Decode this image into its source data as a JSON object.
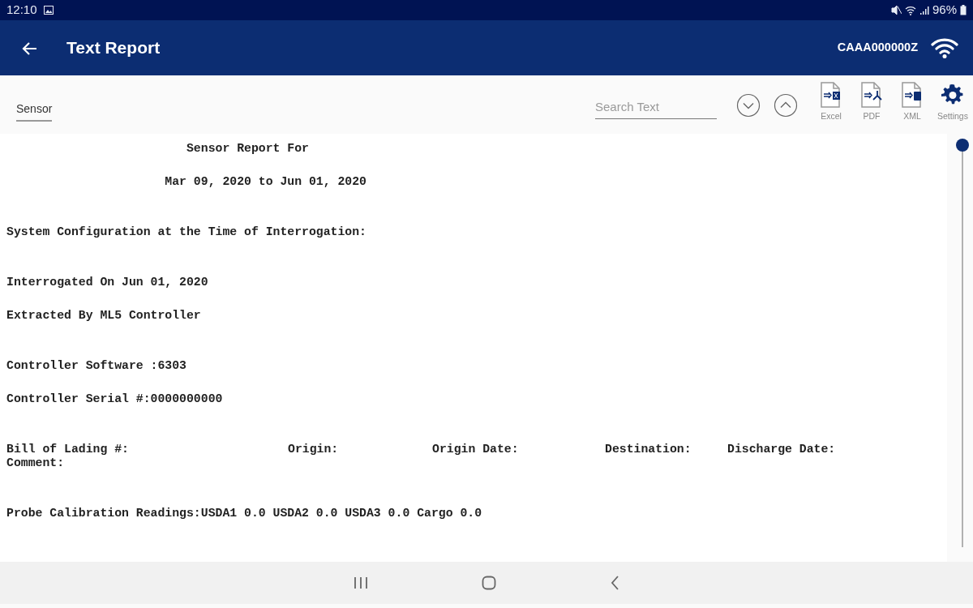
{
  "status_bar": {
    "time": "12:10",
    "battery": "96%"
  },
  "app_bar": {
    "title": "Text Report",
    "device_id": "CAAA000000Z"
  },
  "toolbar": {
    "tab": "Sensor",
    "search": {
      "placeholder": "Search Text"
    },
    "exports": [
      {
        "kind": "excel",
        "label": "Excel"
      },
      {
        "kind": "pdf",
        "label": "PDF"
      },
      {
        "kind": "xml",
        "label": "XML"
      },
      {
        "kind": "settings",
        "label": "Settings"
      }
    ]
  },
  "report": {
    "sections": [
      {
        "lines": [
          {
            "kind": "line",
            "text": "                         Sensor Report For"
          },
          {
            "kind": "line",
            "text": "                      Mar 09, 2020 to Jun 01, 2020"
          }
        ]
      },
      {
        "lines": [
          {
            "kind": "line",
            "text": "System Configuration at the Time of Interrogation:"
          }
        ]
      },
      {
        "lines": [
          {
            "kind": "line",
            "text": "Interrogated On Jun 01, 2020"
          },
          {
            "kind": "line",
            "text": "Extracted By ML5 Controller"
          }
        ]
      },
      {
        "lines": [
          {
            "kind": "line",
            "text": "Controller Software :6303"
          },
          {
            "kind": "line",
            "text": "Controller Serial #:0000000000"
          }
        ]
      },
      {
        "lines": [
          {
            "kind": "fields",
            "fields": [
              "Bill of Lading #:",
              "Origin:",
              "Origin Date:",
              "Destination:",
              "Discharge Date:"
            ]
          },
          {
            "kind": "tight",
            "text": "Comment:"
          }
        ]
      },
      {
        "lines": [
          {
            "kind": "line",
            "text": "Probe Calibration Readings:USDA1 0.0 USDA2 0.0 USDA3 0.0 Cargo 0.0"
          }
        ]
      }
    ]
  }
}
